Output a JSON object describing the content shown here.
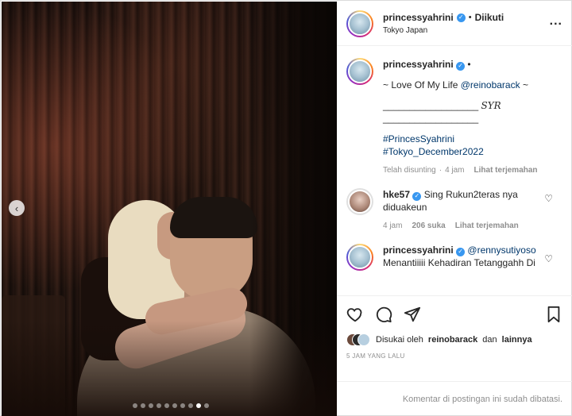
{
  "post": {
    "header": {
      "username": "princessyahrini",
      "separator": "•",
      "follow_status": "Diikuti",
      "location": "Tokyo Japan",
      "more_label": "..."
    },
    "caption": {
      "username": "princessyahrini",
      "separator": "•",
      "line1_prefix": "~ Love Of My Life ",
      "line1_mention": "@reinobarack",
      "line1_suffix": " ~",
      "line2_rule": "__________________",
      "line2_sig": "SYR",
      "line3_rule": "__________________",
      "hashtag1": "#PrincesSyahrini",
      "hashtag2": "#Tokyo_December2022",
      "edited": "Telah disunting",
      "dot": "·",
      "age": "4 jam",
      "translate": "Lihat terjemahan"
    },
    "comments": [
      {
        "username": "hke57",
        "text_line1": "Sing Rukun2teras nya",
        "text_line2": "diduakeun",
        "age": "4 jam",
        "likes": "206 suka",
        "translate": "Lihat terjemahan"
      },
      {
        "username": "princessyahrini",
        "mention": "@rennysutiyoso",
        "text_line1": "Menantiiiii Kehadiran Tetanggahh Di"
      }
    ],
    "likes": {
      "prefix": "Disukai oleh",
      "user": "reinobarack",
      "conj": "dan",
      "others": "lainnya"
    },
    "timestamp": "5 JAM YANG LALU",
    "comments_disabled": "Komentar di postingan ini sudah dibatasi.",
    "carousel": {
      "prev_icon": "‹",
      "total_slides": 10,
      "active_slide": 9
    }
  },
  "icons": {
    "verified": "✓",
    "heart": "♡",
    "comment": "comment-icon",
    "share": "share-icon",
    "bookmark": "bookmark-icon"
  },
  "colors": {
    "link": "#00376b",
    "verified": "#3897f0",
    "muted": "#8e8e8e"
  }
}
